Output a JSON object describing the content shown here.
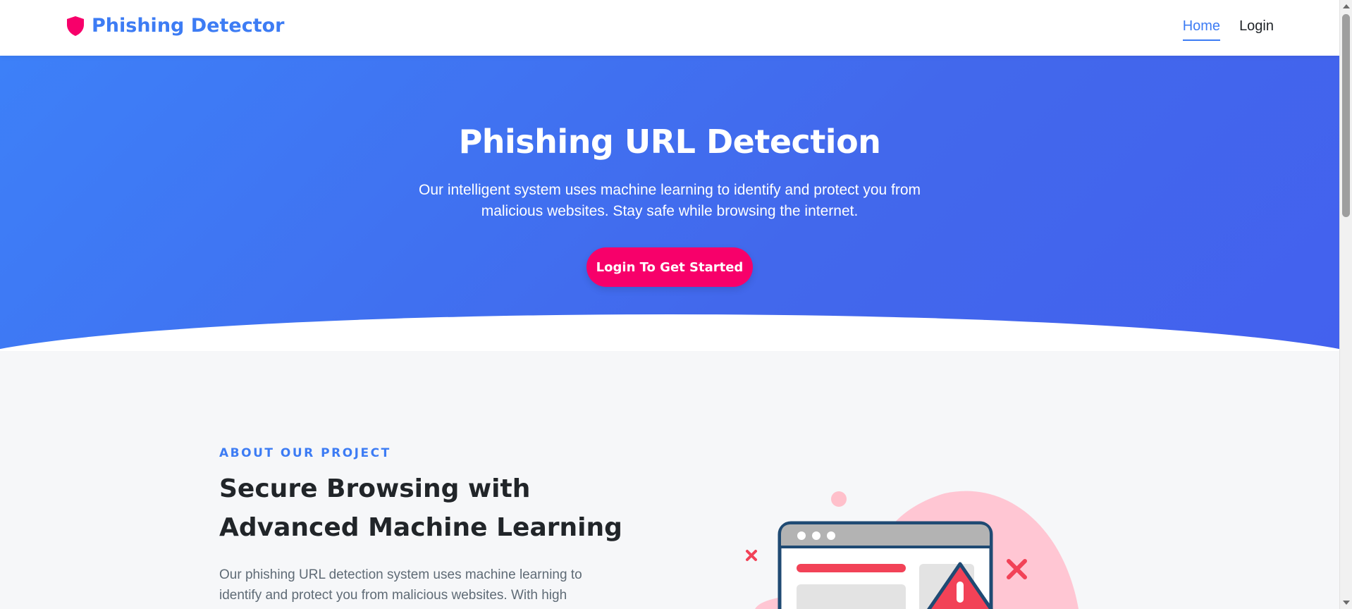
{
  "navbar": {
    "brand": "Phishing Detector",
    "brand_icon": "shield-icon",
    "links": [
      {
        "label": "Home",
        "active": true
      },
      {
        "label": "Login",
        "active": false
      }
    ]
  },
  "hero": {
    "title": "Phishing URL Detection",
    "subtitle": "Our intelligent system uses machine learning to identify and protect you from malicious websites. Stay safe while browsing the internet.",
    "cta_label": "Login To Get Started"
  },
  "about": {
    "kicker": "ABOUT OUR PROJECT",
    "title": "Secure Browsing with Advanced Machine Learning",
    "text": "Our phishing URL detection system uses machine learning to identify and protect you from malicious websites. With high"
  },
  "colors": {
    "accent": "#3d7cf4",
    "cta": "#f7006a",
    "hero_gradient_start": "#3d80f8",
    "hero_gradient_end": "#4361ee",
    "illustration_blob": "#ffc6d3",
    "warning_red": "#f24257"
  }
}
